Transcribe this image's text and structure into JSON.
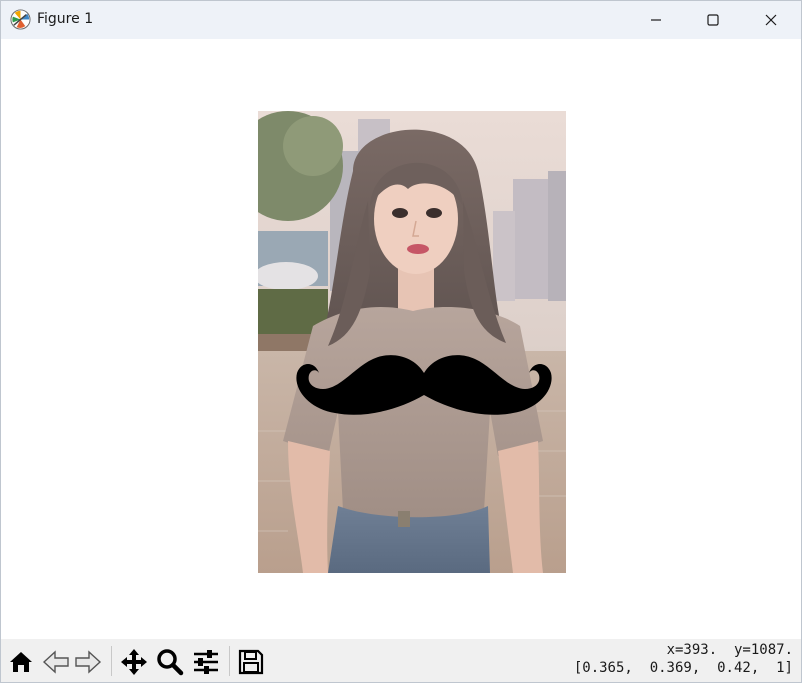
{
  "window": {
    "title": "Figure 1",
    "icons": {
      "app": "matplotlib-icon",
      "minimize": "minimize-icon",
      "maximize": "maximize-icon",
      "close": "close-icon"
    }
  },
  "figure": {
    "image_description_icon": "photo-image",
    "overlay_icon": "mustache-icon"
  },
  "toolbar": {
    "tools": [
      {
        "name": "home",
        "icon": "home-icon"
      },
      {
        "name": "back",
        "icon": "back-arrow-icon"
      },
      {
        "name": "forward",
        "icon": "forward-arrow-icon"
      },
      {
        "name": "pan",
        "icon": "move-icon"
      },
      {
        "name": "zoom",
        "icon": "zoom-icon"
      },
      {
        "name": "configure",
        "icon": "sliders-icon"
      },
      {
        "name": "save",
        "icon": "save-icon"
      }
    ],
    "coords_line1": "x=393.  y=1087.",
    "coords_line2": "[0.365,  0.369,  0.42,  1]"
  }
}
